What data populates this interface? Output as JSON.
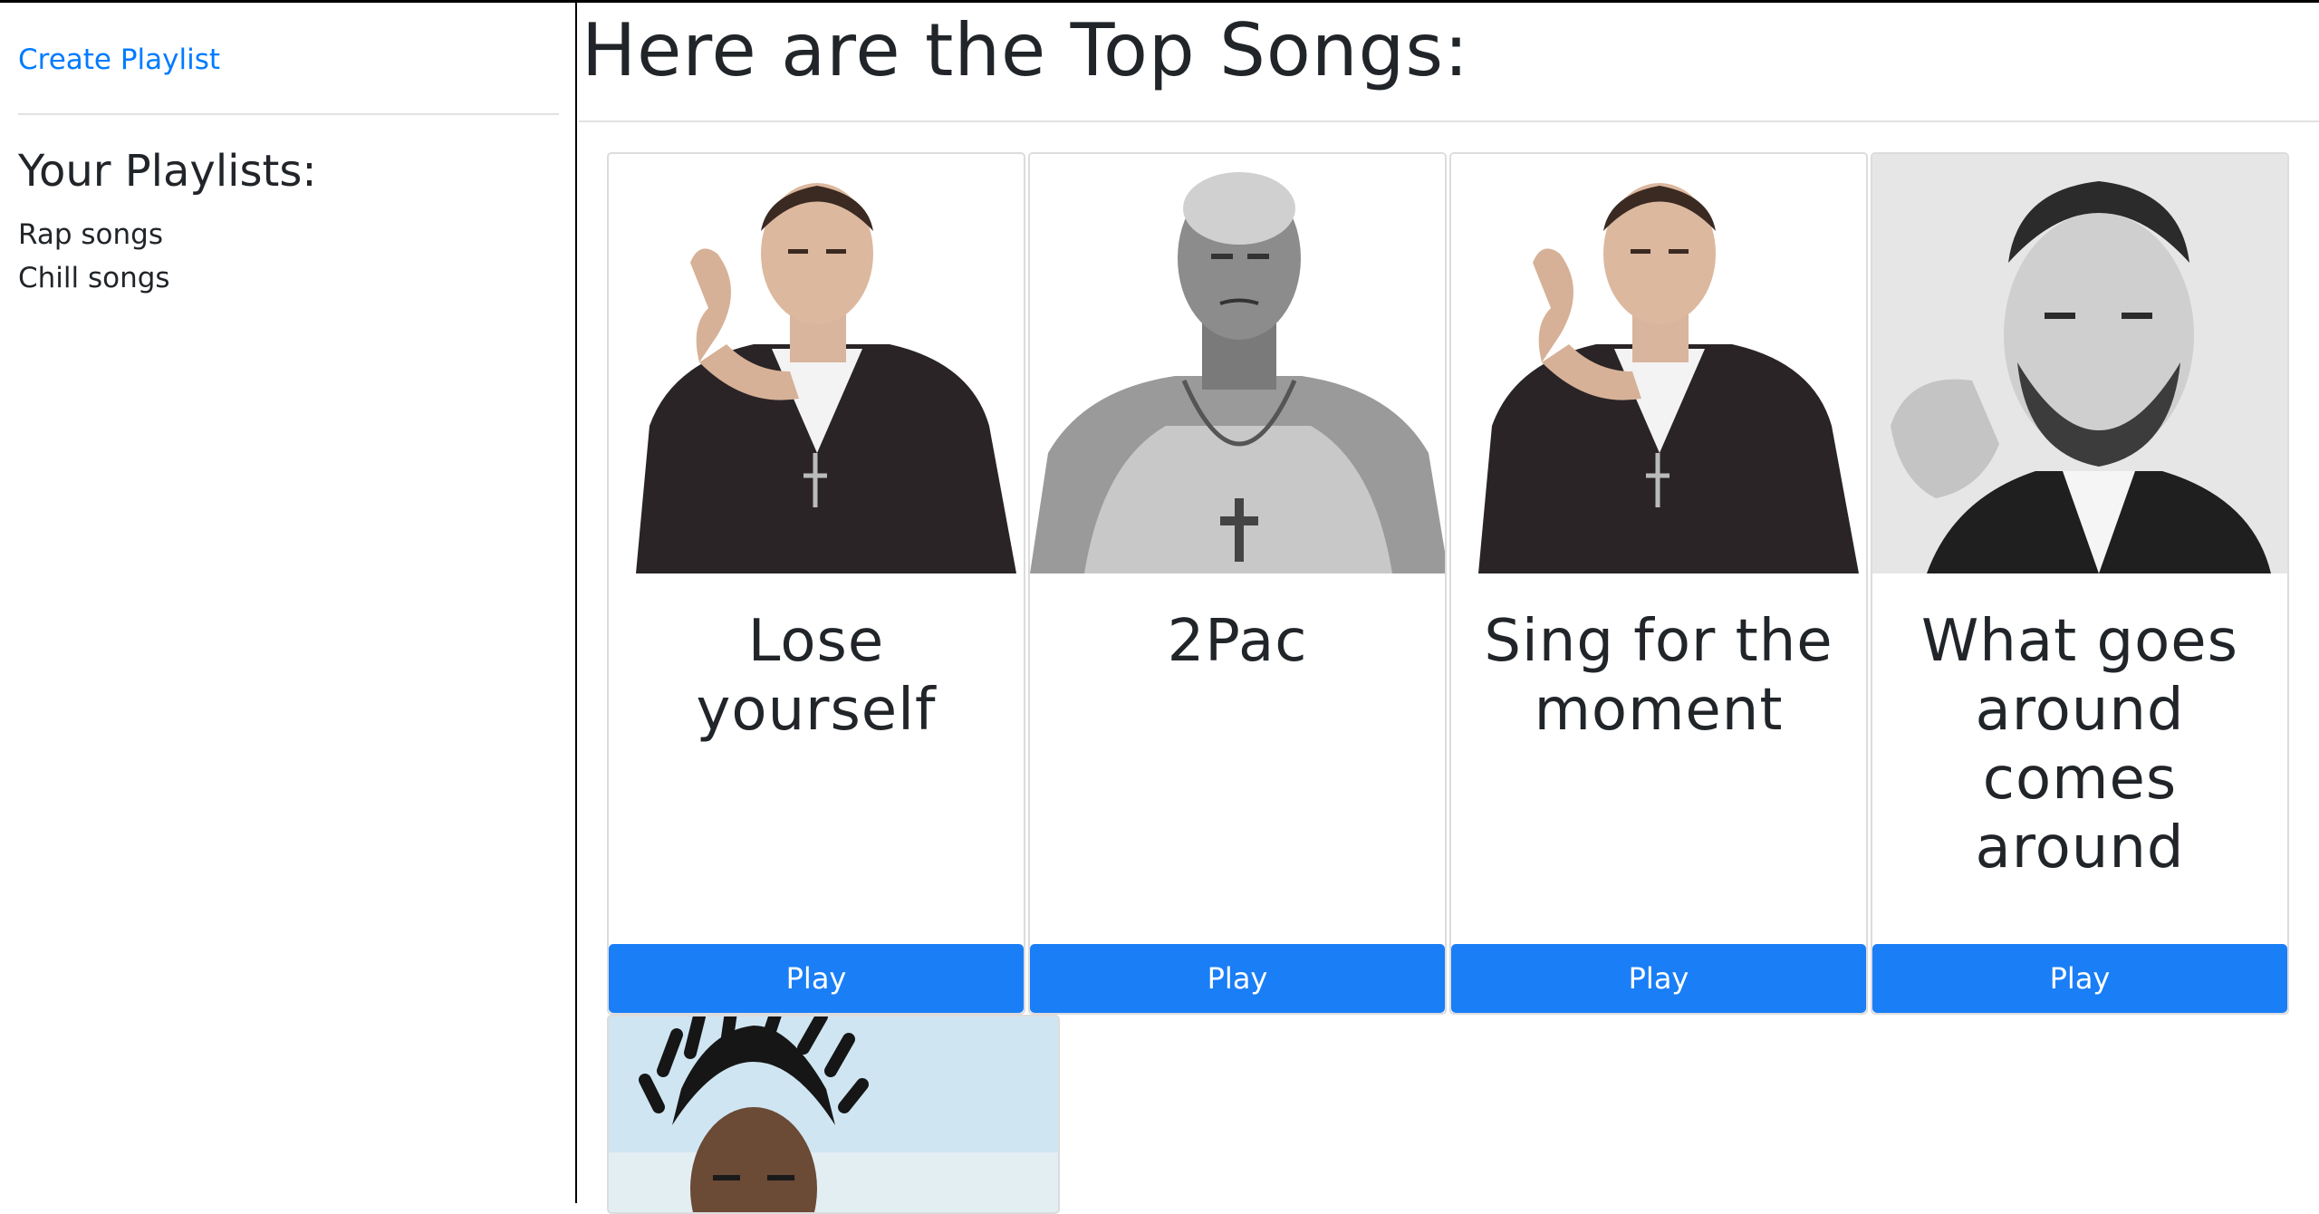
{
  "sidebar": {
    "create_link": "Create Playlist",
    "playlists_heading": "Your Playlists:",
    "playlists": [
      "Rap songs",
      "Chill songs"
    ]
  },
  "main": {
    "title": "Here are the Top Songs:",
    "play_label": "Play",
    "songs": [
      {
        "title": "Lose yourself",
        "photo": "eminem-photo"
      },
      {
        "title": "2Pac",
        "photo": "2pac-photo"
      },
      {
        "title": "Sing for the moment",
        "photo": "eminem-photo"
      },
      {
        "title": "What goes around comes around",
        "photo": "justin-timberlake-photo"
      },
      {
        "photo": "the-weeknd-photo"
      }
    ]
  },
  "colors": {
    "accent": "#1a7ef6",
    "link": "#007bff"
  }
}
